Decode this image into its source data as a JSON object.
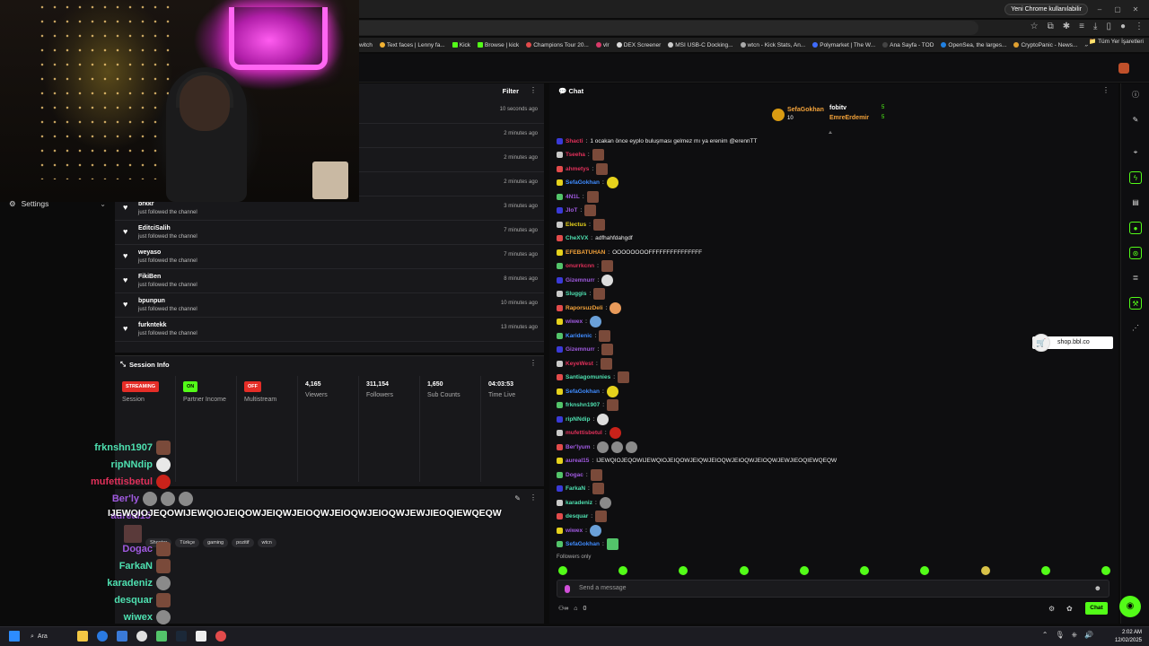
{
  "browser": {
    "promo_label": "Yeni Chrome kullanılabilir",
    "bookmarks": [
      "witch",
      "Text faces | Lenny fa...",
      "Kick",
      "Browse | kick",
      "Champions Tour 20...",
      "vlr",
      "DEX Screener",
      "MSI USB-C Docking...",
      "wtcn - Kick Stats, An...",
      "Polymarket | The W...",
      "Ana Sayfa - TOD",
      "OpenSea, the larges...",
      "CryptoPanic - News..."
    ],
    "bookmarks_more": "»",
    "all_bookmarks": "Tüm Yer İşaretleri"
  },
  "left": {
    "settings_label": "Settings"
  },
  "activity": {
    "filter_label": "Filter",
    "rows": [
      {
        "name": "",
        "sub": "",
        "time": "10 seconds ago"
      },
      {
        "name": "",
        "sub": "",
        "time": "2 minutes ago"
      },
      {
        "name": "",
        "sub": "",
        "time": "2 minutes ago"
      },
      {
        "name": "",
        "sub": "",
        "time": "2 minutes ago"
      },
      {
        "name": "brkkr",
        "sub": "just followed the channel",
        "time": "3 minutes ago"
      },
      {
        "name": "EditciSalih",
        "sub": "just followed the channel",
        "time": "7 minutes ago"
      },
      {
        "name": "weyaso",
        "sub": "just followed the channel",
        "time": "7 minutes ago"
      },
      {
        "name": "FikiBen",
        "sub": "just followed the channel",
        "time": "8 minutes ago"
      },
      {
        "name": "bpunpun",
        "sub": "just followed the channel",
        "time": "10 minutes ago"
      },
      {
        "name": "furkntekk",
        "sub": "just followed the channel",
        "time": "13 minutes ago"
      }
    ]
  },
  "session": {
    "title": "Session Info",
    "cols": [
      {
        "badge": "STREAMING",
        "label": "Session"
      },
      {
        "badge": "ON",
        "label": "Partner Income"
      },
      {
        "badge": "OFF",
        "label": "Multistream"
      },
      {
        "value": "4,165",
        "label": "Viewers"
      },
      {
        "value": "311,154",
        "label": "Followers"
      },
      {
        "value": "1,650",
        "label": "Sub Counts"
      },
      {
        "value": "04:03:53",
        "label": "Time Live"
      }
    ]
  },
  "streaminfo": {
    "tags": [
      "Shooter",
      "Türkçe",
      "gaming",
      "pozitif",
      "wtcn"
    ]
  },
  "overlay_chat": {
    "lines": [
      {
        "name": "frknshn1907",
        "color": "#4ee0b0"
      },
      {
        "name": "ripNNdip",
        "color": "#4ee0b0"
      },
      {
        "name": "mufettisbetul",
        "color": "#e0305a"
      },
      {
        "name": "Ber'ly",
        "color": "#a05ae0"
      },
      {
        "name": "aureal15",
        "color": "#a05ae0"
      },
      {
        "name": "Dogac",
        "color": "#a05ae0"
      },
      {
        "name": "FarkaN",
        "color": "#4ee0b0"
      },
      {
        "name": "karadeniz",
        "color": "#4ee0b0"
      },
      {
        "name": "desquar",
        "color": "#4ee0b0"
      },
      {
        "name": "wiwex",
        "color": "#4ee0b0"
      }
    ],
    "message": "IJEWQIOJEQOWIJEWQIOJEIQOWJEIQWJEIOQWJEIOQWJEIOQWJEWJIEOQIEWQEQW"
  },
  "chat": {
    "title": "Chat",
    "pinned": {
      "gifter": "SefaGokhan",
      "gift_count": "10",
      "top": [
        {
          "name": "fobitv",
          "count": "5"
        },
        {
          "name": "EmreErdemir",
          "count": "5"
        }
      ]
    },
    "messages": [
      {
        "user": "Shacti",
        "color": "#e0305a",
        "text": "1 ocakan önce eyplo buluşması gelmez mı ya erenim @erennTT",
        "emotes": []
      },
      {
        "user": "Tseeha",
        "color": "#e0305a",
        "text": "",
        "emotes": [
          "brown"
        ]
      },
      {
        "user": "ahmetys",
        "color": "#e0305a",
        "text": "",
        "emotes": [
          "brown"
        ]
      },
      {
        "user": "SefaGokhan",
        "color": "#3f8cff",
        "text": "",
        "emotes": [
          "yellow"
        ]
      },
      {
        "user": "4N1L",
        "color": "#a05ae0",
        "text": "",
        "emotes": [
          "brown"
        ]
      },
      {
        "user": "JloT",
        "color": "#a05ae0",
        "text": "",
        "emotes": [
          "brown"
        ]
      },
      {
        "user": "Electus",
        "color": "#e6d21c",
        "text": "",
        "emotes": [
          "brown"
        ]
      },
      {
        "user": "CheXVX",
        "color": "#4ee0b0",
        "text": "adfhahfdahgdf",
        "emotes": []
      },
      {
        "user": "EFEBATUHAN",
        "color": "#f2a23a",
        "text": "OOOOOOOOFFFFFFFFFFFFFFF",
        "emotes": []
      },
      {
        "user": "onurrkcnn",
        "color": "#e0305a",
        "text": "",
        "emotes": [
          "brown"
        ]
      },
      {
        "user": "Gizemnurr",
        "color": "#a05ae0",
        "text": "",
        "emotes": [
          "white"
        ]
      },
      {
        "user": "Sluggis",
        "color": "#4ee0b0",
        "text": "",
        "emotes": [
          "brown"
        ]
      },
      {
        "user": "RaporsuzDeli",
        "color": "#f2a23a",
        "text": "",
        "emotes": [
          "orange"
        ]
      },
      {
        "user": "wiwex",
        "color": "#a05ae0",
        "text": "",
        "emotes": [
          "blue"
        ]
      },
      {
        "user": "Karidenic",
        "color": "#3f8cff",
        "text": "",
        "emotes": [
          "brown"
        ]
      },
      {
        "user": "Gizemnurr",
        "color": "#a05ae0",
        "text": "",
        "emotes": [
          "brown"
        ]
      },
      {
        "user": "KeyeWest",
        "color": "#e0305a",
        "text": "",
        "emotes": [
          "brown"
        ]
      },
      {
        "user": "Santiagomunies",
        "color": "#4ee0b0",
        "text": "",
        "emotes": [
          "brown"
        ]
      },
      {
        "user": "SefaGokhan",
        "color": "#3f8cff",
        "text": "",
        "emotes": [
          "yellow"
        ]
      },
      {
        "user": "frknshn1907",
        "color": "#4ee0b0",
        "text": "",
        "emotes": [
          "brown"
        ]
      },
      {
        "user": "ripNNdip",
        "color": "#4ee0b0",
        "text": "",
        "emotes": [
          "white"
        ]
      },
      {
        "user": "mufettisbetul",
        "color": "#e0305a",
        "text": "",
        "emotes": [
          "red"
        ]
      },
      {
        "user": "Ber'lyum",
        "color": "#a05ae0",
        "text": "",
        "emotes": [
          "grey",
          "grey",
          "grey"
        ]
      },
      {
        "user": "aureal15",
        "color": "#a05ae0",
        "text": "IJEWQIOJEQOWIJEWQIOJEIQOWJEIQWJEIOQWJEIOQWJEIOQWJEWJIEOQIEWQEQW",
        "emotes": []
      },
      {
        "user": "Dogac",
        "color": "#a05ae0",
        "text": "",
        "emotes": [
          "brown"
        ]
      },
      {
        "user": "FarkaN",
        "color": "#4ee0b0",
        "text": "",
        "emotes": [
          "brown"
        ]
      },
      {
        "user": "karadeniz",
        "color": "#4ee0b0",
        "text": "",
        "emotes": [
          "grey"
        ]
      },
      {
        "user": "desquar",
        "color": "#4ee0b0",
        "text": "",
        "emotes": [
          "brown"
        ]
      },
      {
        "user": "wiwex",
        "color": "#a05ae0",
        "text": "",
        "emotes": [
          "blue"
        ]
      },
      {
        "user": "SefaGokhan",
        "color": "#3f8cff",
        "text": "",
        "emotes": [
          "green"
        ]
      }
    ],
    "followers_only": "Followers only",
    "send_placeholder": "Send a message",
    "foot_count": "0",
    "chat_button": "Chat"
  },
  "shop": {
    "label": "shop.bbl.co"
  },
  "taskbar": {
    "search_label": "Ara",
    "time": "2:02 AM",
    "date": "12/02/2025"
  },
  "colors": {
    "kick_green": "#53fc18",
    "streaming_red": "#e52d27",
    "panel_bg": "#18181b"
  }
}
